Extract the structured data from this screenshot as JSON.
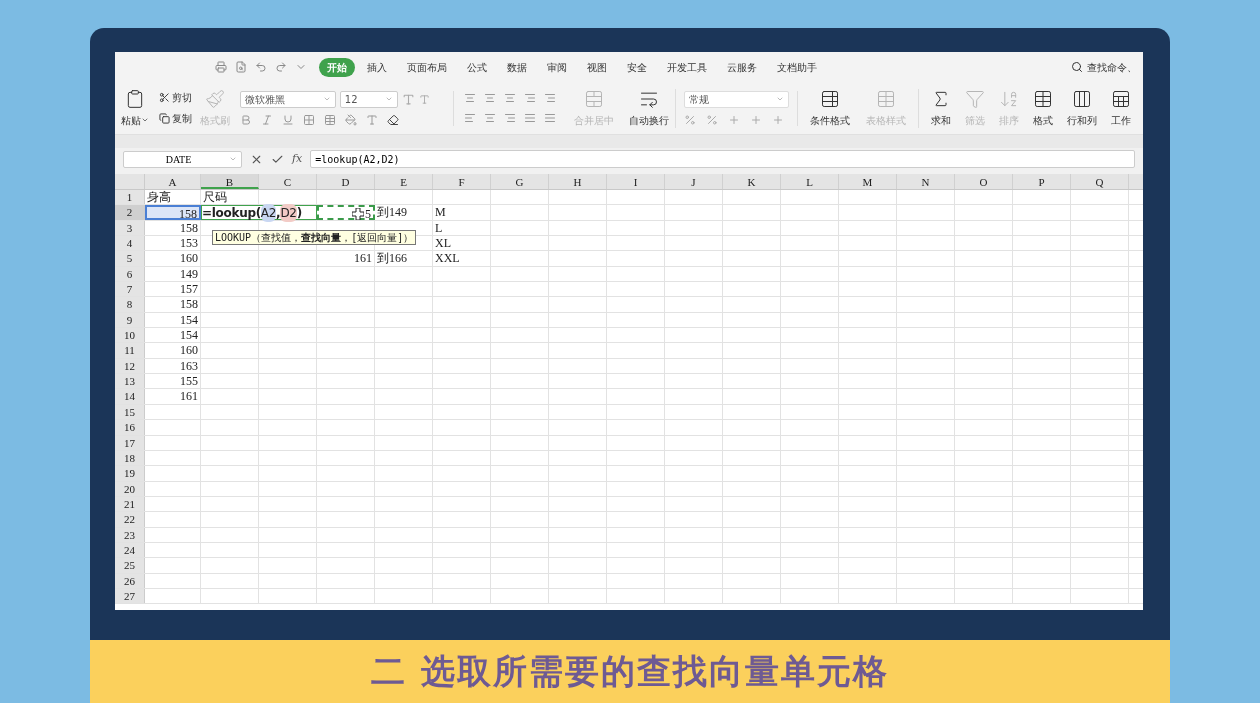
{
  "menu": {
    "tabs": [
      {
        "label": "开始",
        "selected": true
      },
      {
        "label": "插入",
        "selected": false
      },
      {
        "label": "页面布局",
        "selected": false
      },
      {
        "label": "公式",
        "selected": false
      },
      {
        "label": "数据",
        "selected": false
      },
      {
        "label": "审阅",
        "selected": false
      },
      {
        "label": "视图",
        "selected": false
      },
      {
        "label": "安全",
        "selected": false
      },
      {
        "label": "开发工具",
        "selected": false
      },
      {
        "label": "云服务",
        "selected": false
      },
      {
        "label": "文档助手",
        "selected": false
      }
    ],
    "search": {
      "placeholder": "查找命令、"
    }
  },
  "ribbon": {
    "paste": {
      "label": "粘贴",
      "disabled": false
    },
    "cut": {
      "label": "剪切",
      "disabled": false
    },
    "copy": {
      "label": "复制",
      "disabled": false
    },
    "format_painter": {
      "label": "格式刷",
      "disabled": true
    },
    "font": {
      "value": "微软雅黑"
    },
    "font_size": {
      "value": "12"
    },
    "merge": {
      "label": "合并居中",
      "disabled": true
    },
    "wrap": {
      "label": "自动换行",
      "disabled": false
    },
    "number_format": {
      "value": "常规"
    },
    "tools": [
      {
        "label": "条件格式",
        "disabled": false
      },
      {
        "label": "表格样式",
        "disabled": true
      }
    ],
    "tools2": [
      {
        "label": "求和",
        "disabled": false
      },
      {
        "label": "筛选",
        "disabled": true
      },
      {
        "label": "排序",
        "disabled": true
      },
      {
        "label": "格式",
        "disabled": false
      },
      {
        "label": "行和列",
        "disabled": false
      },
      {
        "label": "工作",
        "disabled": false
      }
    ]
  },
  "formula_bar": {
    "name_box": "DATE",
    "function_label": "fx",
    "formula": "=lookup(A2,D2)"
  },
  "sheet": {
    "columns": [
      {
        "label": "A",
        "selected": false
      },
      {
        "label": "B",
        "selected": true
      },
      {
        "label": "C",
        "selected": false
      },
      {
        "label": "D",
        "selected": false
      },
      {
        "label": "E",
        "selected": false
      },
      {
        "label": "F",
        "selected": false
      },
      {
        "label": "G",
        "selected": false
      },
      {
        "label": "H",
        "selected": false
      },
      {
        "label": "I",
        "selected": false
      },
      {
        "label": "J",
        "selected": false
      },
      {
        "label": "K",
        "selected": false
      },
      {
        "label": "L",
        "selected": false
      },
      {
        "label": "M",
        "selected": false
      },
      {
        "label": "N",
        "selected": false
      },
      {
        "label": "O",
        "selected": false
      },
      {
        "label": "P",
        "selected": false
      },
      {
        "label": "Q",
        "selected": false
      }
    ],
    "rows": [
      {
        "header": "1",
        "selected": false,
        "a": {
          "text": "身高"
        },
        "b": {
          "text": "尺码"
        }
      },
      {
        "header": "2",
        "selected": true,
        "a": {
          "text": "158",
          "kind": "number",
          "color": "#4a7fd4"
        },
        "b": {
          "kind": "editor",
          "parts": [
            {
              "text": "=lookup("
            },
            {
              "text": "A2",
              "color": "#c9d7f2"
            },
            {
              "text": ","
            },
            {
              "text": "D2",
              "color": "#f2cbc6"
            },
            {
              "text": ")"
            }
          ]
        },
        "d": {
          "text": "5",
          "kind": "number",
          "color": "#3a9a4a"
        },
        "e": {
          "text": "到149"
        },
        "f": {
          "text": "M"
        }
      },
      {
        "header": "3",
        "selected": false,
        "a": {
          "text": "158",
          "kind": "number"
        },
        "f": {
          "text": "L"
        }
      },
      {
        "header": "4",
        "selected": false,
        "a": {
          "text": "153",
          "kind": "number"
        },
        "f": {
          "text": "XL"
        }
      },
      {
        "header": "5",
        "selected": false,
        "a": {
          "text": "160",
          "kind": "number"
        },
        "d": {
          "text": "161",
          "kind": "number"
        },
        "e": {
          "text": "到166"
        },
        "f": {
          "text": "XXL"
        }
      },
      {
        "header": "6",
        "selected": false,
        "a": {
          "text": "149",
          "kind": "number"
        }
      },
      {
        "header": "7",
        "selected": false,
        "a": {
          "text": "157",
          "kind": "number"
        }
      },
      {
        "header": "8",
        "selected": false,
        "a": {
          "text": "158",
          "kind": "number"
        }
      },
      {
        "header": "9",
        "selected": false,
        "a": {
          "text": "154",
          "kind": "number"
        }
      },
      {
        "header": "10",
        "selected": false,
        "a": {
          "text": "154",
          "kind": "number"
        }
      },
      {
        "header": "11",
        "selected": false,
        "a": {
          "text": "160",
          "kind": "number"
        }
      },
      {
        "header": "12",
        "selected": false,
        "a": {
          "text": "163",
          "kind": "number"
        }
      },
      {
        "header": "13",
        "selected": false,
        "a": {
          "text": "155",
          "kind": "number"
        }
      },
      {
        "header": "14",
        "selected": false,
        "a": {
          "text": "161",
          "kind": "number"
        }
      },
      {
        "header": "15",
        "selected": false
      },
      {
        "header": "16",
        "selected": false
      },
      {
        "header": "17",
        "selected": false
      },
      {
        "header": "18",
        "selected": false
      },
      {
        "header": "19",
        "selected": false
      },
      {
        "header": "20",
        "selected": false
      },
      {
        "header": "21",
        "selected": false
      },
      {
        "header": "22",
        "selected": false
      },
      {
        "header": "23",
        "selected": false
      },
      {
        "header": "24",
        "selected": false
      },
      {
        "header": "25",
        "selected": false
      },
      {
        "header": "26",
        "selected": false
      },
      {
        "header": "27",
        "selected": false
      }
    ],
    "tooltip": "LOOKUP（查找值，**查找向量**，[返回向量]）"
  },
  "caption": "二 选取所需要的查找向量单元格"
}
